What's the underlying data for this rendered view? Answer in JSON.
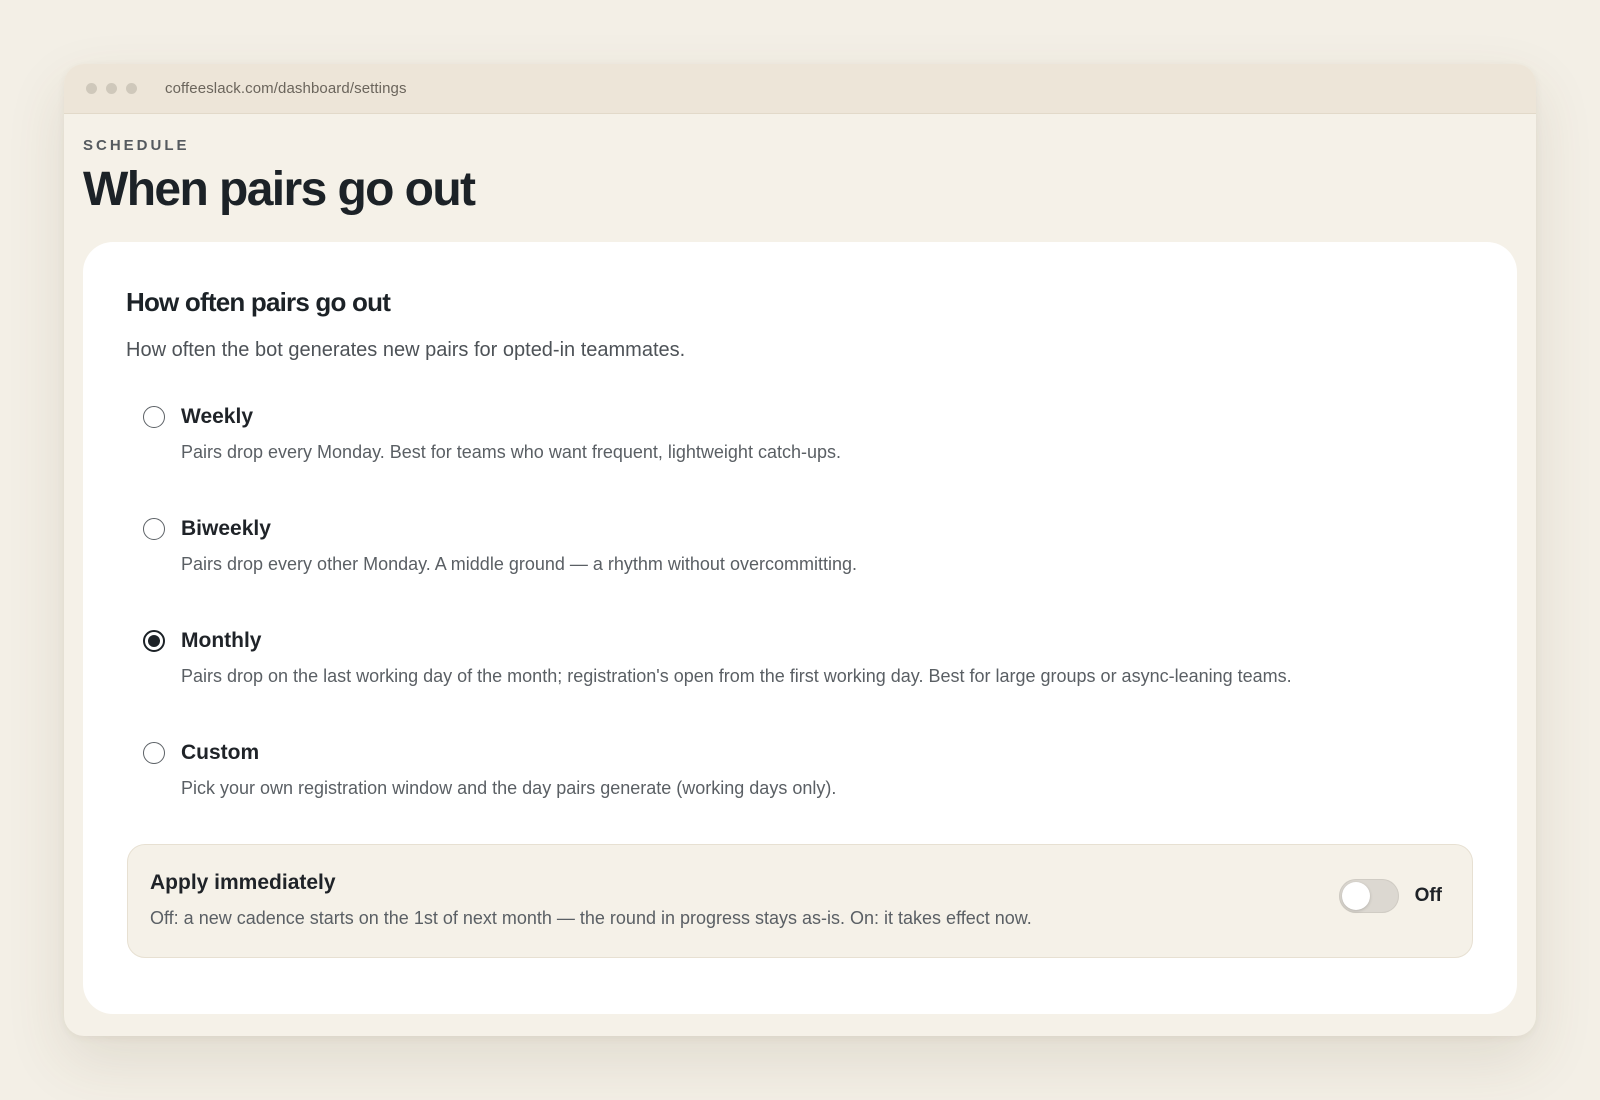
{
  "browser": {
    "url": "coffeeslack.com/dashboard/settings"
  },
  "page": {
    "eyebrow": "SCHEDULE",
    "title": "When pairs go out"
  },
  "card": {
    "title": "How often pairs go out",
    "description": "How often the bot generates new pairs for opted-in teammates.",
    "selected": "monthly",
    "options": [
      {
        "id": "weekly",
        "label": "Weekly",
        "description": "Pairs drop every Monday. Best for teams who want frequent, lightweight catch-ups."
      },
      {
        "id": "biweekly",
        "label": "Biweekly",
        "description": "Pairs drop every other Monday. A middle ground — a rhythm without overcommitting."
      },
      {
        "id": "monthly",
        "label": "Monthly",
        "description": "Pairs drop on the last working day of the month; registration's open from the first working day. Best for large groups or async-leaning teams."
      },
      {
        "id": "custom",
        "label": "Custom",
        "description": "Pick your own registration window and the day pairs generate (working days only)."
      }
    ]
  },
  "apply": {
    "title": "Apply immediately",
    "description": "Off: a new cadence starts on the 1st of next month — the round in progress stays as-is. On: it takes effect now.",
    "toggle_on": false,
    "toggle_label": "Off"
  }
}
